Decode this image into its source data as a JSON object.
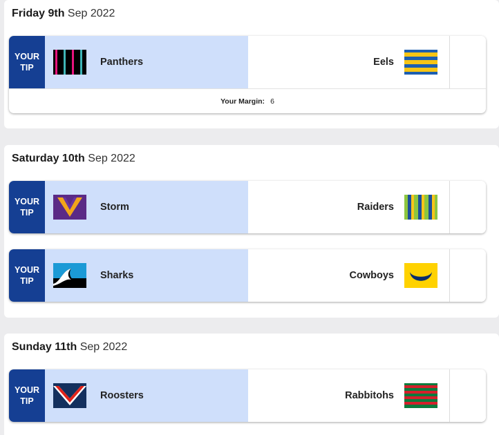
{
  "days": [
    {
      "day_name": "Friday 9th",
      "day_date": "Sep 2022",
      "matches": [
        {
          "tip_line1": "YOUR",
          "tip_line2": "TIP",
          "home": {
            "name": "Panthers",
            "logo_icon": "panthers-logo-icon"
          },
          "away": {
            "name": "Eels",
            "logo_icon": "eels-logo-icon"
          },
          "margin_label": "Your Margin:",
          "margin_value": "6"
        }
      ]
    },
    {
      "day_name": "Saturday 10th",
      "day_date": "Sep 2022",
      "matches": [
        {
          "tip_line1": "YOUR",
          "tip_line2": "TIP",
          "home": {
            "name": "Storm",
            "logo_icon": "storm-logo-icon"
          },
          "away": {
            "name": "Raiders",
            "logo_icon": "raiders-logo-icon"
          }
        },
        {
          "tip_line1": "YOUR",
          "tip_line2": "TIP",
          "home": {
            "name": "Sharks",
            "logo_icon": "sharks-logo-icon"
          },
          "away": {
            "name": "Cowboys",
            "logo_icon": "cowboys-logo-icon"
          }
        }
      ]
    },
    {
      "day_name": "Sunday 11th",
      "day_date": "Sep 2022",
      "matches": [
        {
          "tip_line1": "YOUR",
          "tip_line2": "TIP",
          "home": {
            "name": "Roosters",
            "logo_icon": "roosters-logo-icon"
          },
          "away": {
            "name": "Rabbitohs",
            "logo_icon": "rabbitohs-logo-icon"
          }
        }
      ]
    }
  ],
  "colors": {
    "tip_badge": "#153f93",
    "selected_team_bg": "#cfdffb",
    "page_bg": "#ececee"
  }
}
